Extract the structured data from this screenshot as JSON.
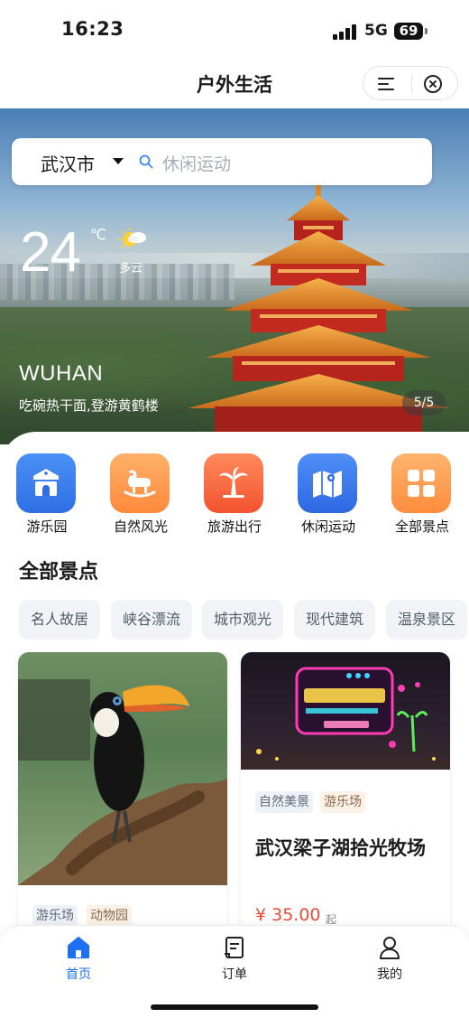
{
  "status_bar": {
    "time": "16:23",
    "network": "5G",
    "battery": "69"
  },
  "nav": {
    "title": "户外生活"
  },
  "hero": {
    "city_select": "武汉市",
    "search_placeholder": "休闲运动",
    "temperature": "24",
    "temperature_unit": "℃",
    "weather": "多云",
    "city_en": "WUHAN",
    "slogan": "吃碗热干面,登游黄鹤楼",
    "page_indicator": "5/5"
  },
  "categories": [
    {
      "label": "游乐园",
      "color_from": "#4a90f5",
      "color_to": "#2f6fe6"
    },
    {
      "label": "自然风光",
      "color_from": "#ffb06a",
      "color_to": "#ff8a3c"
    },
    {
      "label": "旅游出行",
      "color_from": "#ff8a5c",
      "color_to": "#f2532e"
    },
    {
      "label": "休闲运动",
      "color_from": "#4f8ff6",
      "color_to": "#2d68e3"
    },
    {
      "label": "全部景点",
      "color_from": "#ffb36e",
      "color_to": "#ff8d3e"
    }
  ],
  "section": {
    "title": "全部景点"
  },
  "tags": [
    "名人故居",
    "峡谷漂流",
    "城市观光",
    "现代建筑",
    "温泉景区"
  ],
  "cards": [
    {
      "tags": [
        "游乐场",
        "动物园"
      ],
      "name": "",
      "price": "",
      "suffix": ""
    },
    {
      "tags": [
        "自然美景",
        "游乐场"
      ],
      "name": "武汉梁子湖拾光牧场",
      "price": "¥ 35.00",
      "suffix": "起"
    }
  ],
  "tab_bar": {
    "items": [
      {
        "label": "首页",
        "active": true
      },
      {
        "label": "订单",
        "active": false
      },
      {
        "label": "我的",
        "active": false
      }
    ],
    "active_color": "#1e6ff1",
    "inactive_color": "#222222"
  },
  "colors": {
    "accent": "#1e6ff1",
    "price": "#ec4b3b"
  }
}
